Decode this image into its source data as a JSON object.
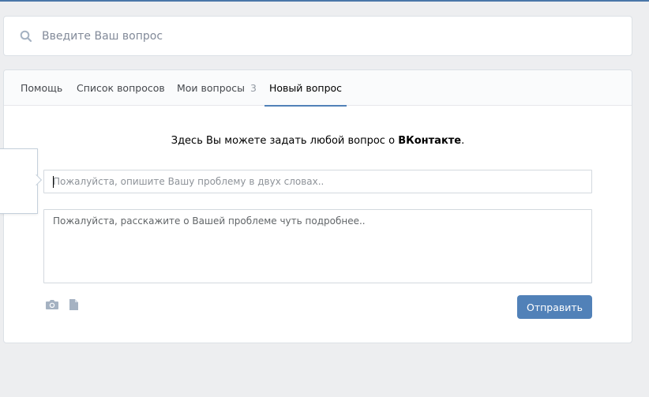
{
  "search": {
    "placeholder": "Введите Ваш вопрос"
  },
  "tabs": [
    {
      "label": "Помощь",
      "active": false
    },
    {
      "label": "Список вопросов",
      "active": false
    },
    {
      "label": "Мои вопросы",
      "count": "3",
      "active": false
    },
    {
      "label": "Новый вопрос",
      "active": true
    }
  ],
  "form": {
    "intro_text": "Здесь Вы можете задать любой вопрос о",
    "intro_brand": "ВКонтакте",
    "intro_end": ".",
    "title_placeholder": "Пожалуйста, опишите Вашу проблему в двух словах..",
    "body_placeholder": "Пожалуйста, расскажите о Вашей проблеме чуть подробнее..",
    "send_label": "Отправить"
  },
  "icons": {
    "search": "search-icon",
    "camera": "camera-icon",
    "document": "document-icon"
  },
  "colors": {
    "accent": "#5181b8",
    "background": "#edeef0",
    "icon": "#a5b2c2"
  }
}
